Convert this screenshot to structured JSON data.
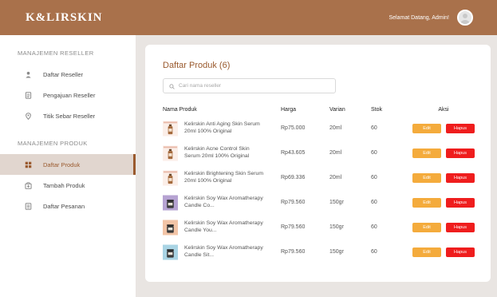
{
  "brand": {
    "logo": "K&LIRSKIN"
  },
  "header": {
    "welcome": "Selamat Datang, Admin!"
  },
  "sidebar": {
    "sections": [
      {
        "title": "MANAJEMEN RESELLER",
        "items": [
          {
            "label": "Daftar Reseller",
            "icon": "user-icon"
          },
          {
            "label": "Pengajuan Reseller",
            "icon": "document-icon"
          },
          {
            "label": "Titik Sebar Reseller",
            "icon": "map-pin-icon"
          }
        ]
      },
      {
        "title": "MANAJEMEN PRODUK",
        "items": [
          {
            "label": "Daftar Produk",
            "icon": "grid-icon",
            "active": true
          },
          {
            "label": "Tambah Produk",
            "icon": "box-add-icon"
          },
          {
            "label": "Daftar Pesanan",
            "icon": "list-icon"
          }
        ]
      }
    ]
  },
  "main": {
    "title": "Daftar Produk (6)",
    "search": {
      "placeholder": "Cari nama reseller",
      "value": ""
    },
    "table": {
      "headers": [
        "Nama Produk",
        "Harga",
        "Varian",
        "Stok",
        "Aksi"
      ],
      "edit_label": "Edit",
      "delete_label": "Hapus",
      "rows": [
        {
          "name": "Kelirskin Anti Aging Skin Serum 20ml 100% Original",
          "price": "Rp75.000",
          "variant": "20ml",
          "stock": "60",
          "thumb": "serum"
        },
        {
          "name": "Kelirskin Acne Control Skin Serum 20ml 100% Original",
          "price": "Rp43.605",
          "variant": "20ml",
          "stock": "60",
          "thumb": "serum"
        },
        {
          "name": "Kelirskin Brightening Skin Serum 20ml 100% Original",
          "price": "Rp69.336",
          "variant": "20ml",
          "stock": "60",
          "thumb": "serum"
        },
        {
          "name": "Kelirskin Soy Wax Aromatherapy Candle Co...",
          "price": "Rp79.560",
          "variant": "150gr",
          "stock": "60",
          "thumb": "candle-purple"
        },
        {
          "name": "Kelirskin Soy Wax Aromatherapy Candle You...",
          "price": "Rp79.560",
          "variant": "150gr",
          "stock": "60",
          "thumb": "candle-peach"
        },
        {
          "name": "Kelirskin Soy Wax Aromatherapy Candle Sit...",
          "price": "Rp79.560",
          "variant": "150gr",
          "stock": "60",
          "thumb": "candle-blue"
        }
      ]
    }
  },
  "colors": {
    "header_bg": "#a9714b",
    "accent": "#9a5a2e",
    "edit": "#f4ab3c",
    "delete": "#ef1d1d"
  }
}
